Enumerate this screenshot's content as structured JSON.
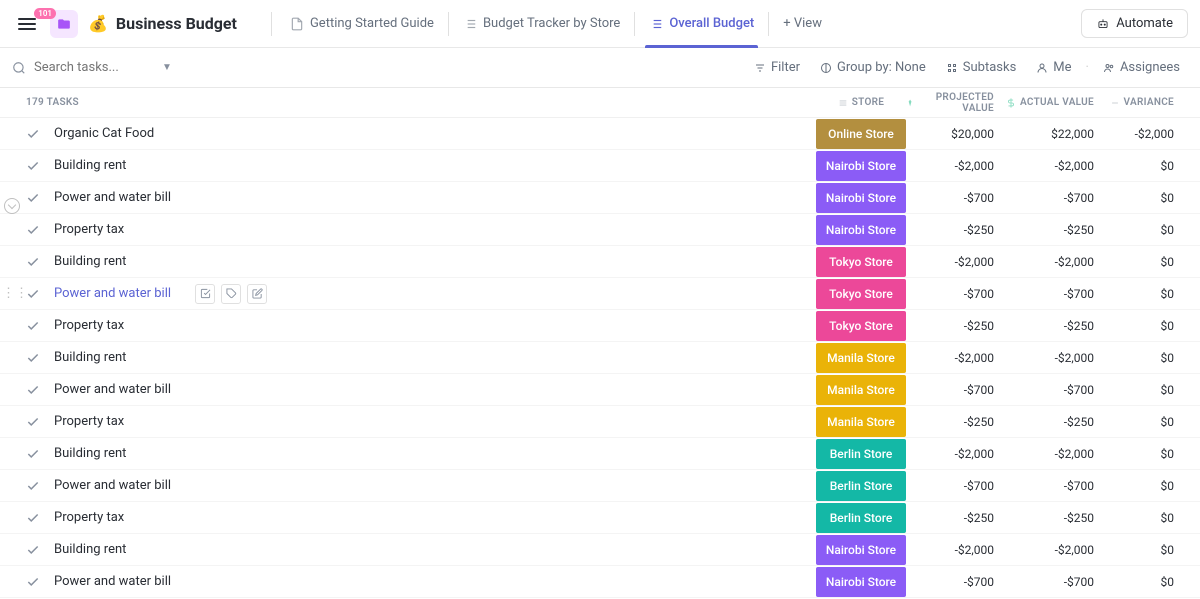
{
  "header": {
    "badge": "101",
    "title": "Business Budget",
    "emoji": "💰",
    "tabs": [
      {
        "label": "Getting Started Guide",
        "active": false
      },
      {
        "label": "Budget Tracker by Store",
        "active": false
      },
      {
        "label": "Overall Budget",
        "active": true
      }
    ],
    "addView": "+ View",
    "automate": "Automate"
  },
  "toolbar": {
    "searchPlaceholder": "Search tasks...",
    "filter": "Filter",
    "groupBy": "Group by: None",
    "subtasks": "Subtasks",
    "me": "Me",
    "assignees": "Assignees"
  },
  "tableHeader": {
    "taskCount": "179 TASKS",
    "store": "STORE",
    "projected": "PROJECTED VALUE",
    "actual": "ACTUAL VALUE",
    "variance": "VARIANCE"
  },
  "storeColors": {
    "Online Store": "#b38f3f",
    "Nairobi Store": "#8b5cf6",
    "Tokyo Store": "#ec4899",
    "Manila Store": "#eab308",
    "Berlin Store": "#14b8a6"
  },
  "rows": [
    {
      "name": "Organic Cat Food",
      "store": "Online Store",
      "projected": "$20,000",
      "actual": "$22,000",
      "variance": "-$2,000"
    },
    {
      "name": "Building rent",
      "store": "Nairobi Store",
      "projected": "-$2,000",
      "actual": "-$2,000",
      "variance": "$0"
    },
    {
      "name": "Power and water bill",
      "store": "Nairobi Store",
      "projected": "-$700",
      "actual": "-$700",
      "variance": "$0"
    },
    {
      "name": "Property tax",
      "store": "Nairobi Store",
      "projected": "-$250",
      "actual": "-$250",
      "variance": "$0"
    },
    {
      "name": "Building rent",
      "store": "Tokyo Store",
      "projected": "-$2,000",
      "actual": "-$2,000",
      "variance": "$0"
    },
    {
      "name": "Power and water bill",
      "store": "Tokyo Store",
      "projected": "-$700",
      "actual": "-$700",
      "variance": "$0",
      "highlighted": true
    },
    {
      "name": "Property tax",
      "store": "Tokyo Store",
      "projected": "-$250",
      "actual": "-$250",
      "variance": "$0"
    },
    {
      "name": "Building rent",
      "store": "Manila Store",
      "projected": "-$2,000",
      "actual": "-$2,000",
      "variance": "$0"
    },
    {
      "name": "Power and water bill",
      "store": "Manila Store",
      "projected": "-$700",
      "actual": "-$700",
      "variance": "$0"
    },
    {
      "name": "Property tax",
      "store": "Manila Store",
      "projected": "-$250",
      "actual": "-$250",
      "variance": "$0"
    },
    {
      "name": "Building rent",
      "store": "Berlin Store",
      "projected": "-$2,000",
      "actual": "-$2,000",
      "variance": "$0"
    },
    {
      "name": "Power and water bill",
      "store": "Berlin Store",
      "projected": "-$700",
      "actual": "-$700",
      "variance": "$0"
    },
    {
      "name": "Property tax",
      "store": "Berlin Store",
      "projected": "-$250",
      "actual": "-$250",
      "variance": "$0"
    },
    {
      "name": "Building rent",
      "store": "Nairobi Store",
      "projected": "-$2,000",
      "actual": "-$2,000",
      "variance": "$0"
    },
    {
      "name": "Power and water bill",
      "store": "Nairobi Store",
      "projected": "-$700",
      "actual": "-$700",
      "variance": "$0"
    }
  ]
}
